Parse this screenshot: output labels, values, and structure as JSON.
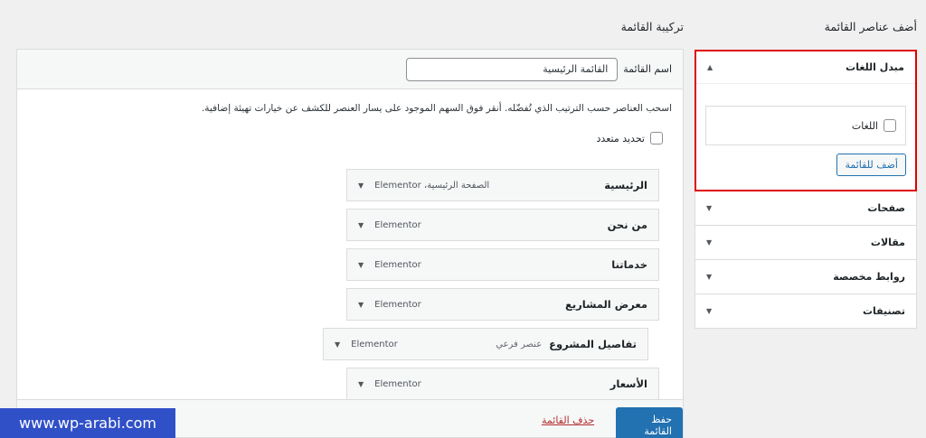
{
  "headings": {
    "add_items": "أضف عناصر القائمة",
    "structure": "تركيبة القائمة"
  },
  "add_panel": {
    "open_section": {
      "title": "مبدل اللغات",
      "checkbox_label": "اللغات",
      "add_button": "أضف للقائمة"
    },
    "sections": [
      {
        "title": "صفحات"
      },
      {
        "title": "مقالات"
      },
      {
        "title": "روابط مخصصة"
      },
      {
        "title": "تصنيفات"
      }
    ]
  },
  "structure": {
    "name_label": "اسم القائمة",
    "name_value": "القائمة الرئيسية",
    "instructions": "اسحب العناصر حسب الترتيب الذي تُفضّله. أنقر فوق السهم الموجود على يسار العنصر للكشف عن خيارات تهيئة إضافية.",
    "bulk_select": "تحديد متعدد",
    "items": [
      {
        "title": "الرئيسية",
        "type": "الصفحة الرئيسية، Elementor",
        "sub": ""
      },
      {
        "title": "من نحن",
        "type": "Elementor",
        "sub": ""
      },
      {
        "title": "خدماتنا",
        "type": "Elementor",
        "sub": ""
      },
      {
        "title": "معرض المشاريع",
        "type": "Elementor",
        "sub": ""
      },
      {
        "title": "تفاصيل المشروع",
        "type": "Elementor",
        "sub": "عنصر فرعي"
      },
      {
        "title": "الأسعار",
        "type": "Elementor",
        "sub": ""
      }
    ],
    "save_button": "حفظ القائمة",
    "delete_link": "حذف القائمة"
  },
  "watermark": "www.wp-arabi.com",
  "colors": {
    "accent": "#2271b1",
    "highlight_border": "#e00000",
    "delete": "#b32d2e"
  }
}
